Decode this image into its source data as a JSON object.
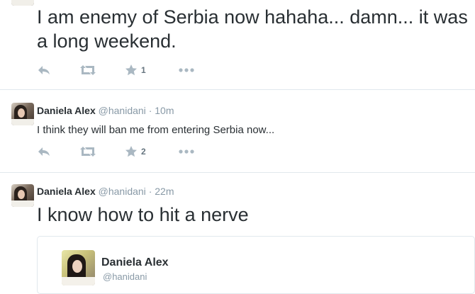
{
  "tweets": [
    {
      "text": "I am enemy of Serbia now hahaha... damn... it was a long weekend.",
      "favorite_count": "1"
    },
    {
      "name": "Daniela Alex",
      "handle": "@hanidani",
      "dot": "·",
      "time": "10m",
      "text": "I think they will ban me from entering Serbia now...",
      "favorite_count": "2"
    },
    {
      "name": "Daniela Alex",
      "handle": "@hanidani",
      "dot": "·",
      "time": "22m",
      "text": "I know how to hit a nerve",
      "quote": {
        "name": "Daniela Alex",
        "handle": "@hanidani"
      }
    }
  ],
  "icons": {
    "reply": "reply-icon",
    "retweet": "retweet-icon",
    "favorite": "star-icon",
    "more": "more-icon"
  },
  "colors": {
    "text": "#292f33",
    "muted": "#8899a6",
    "icon": "#aab8c2",
    "border": "#e1e8ed"
  }
}
